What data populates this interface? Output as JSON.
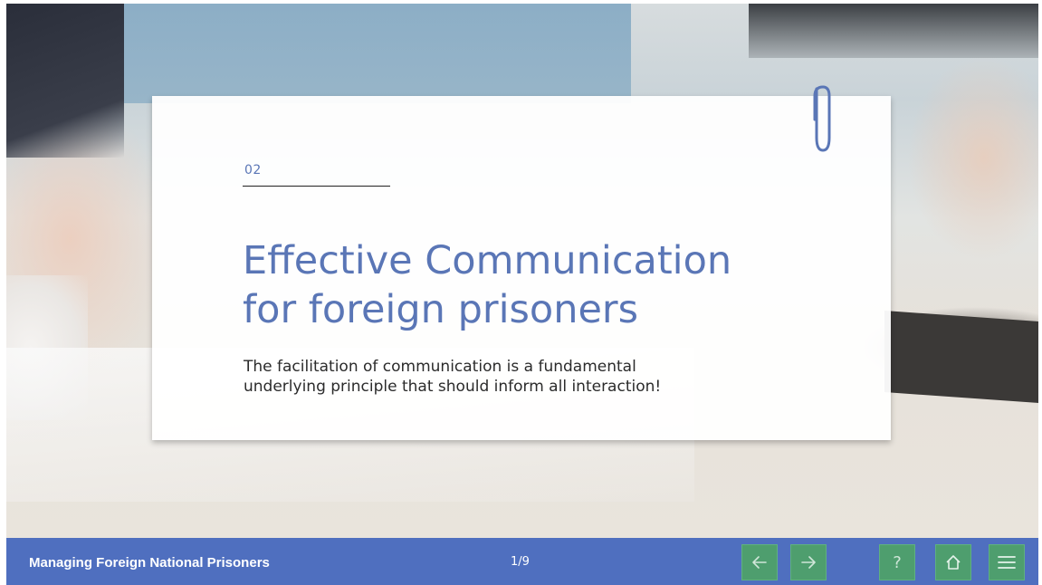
{
  "slide": {
    "section_number": "02",
    "title_lines": [
      "Effective Communication",
      "for foreign prisoners"
    ],
    "body_lines": [
      "The facilitation of communication is a fundamental",
      "underlying principle that should inform all interaction!"
    ]
  },
  "footer": {
    "course_title": "Managing Foreign National Prisoners",
    "page_counter": "1/9",
    "buttons": {
      "prev_icon": "arrow-left-icon",
      "next_icon": "arrow-right-icon",
      "help_label": "?",
      "home_icon": "home-icon",
      "menu_icon": "hamburger-menu-icon"
    }
  },
  "colors": {
    "accent_blue": "#5a76b6",
    "footer_bar": "#4f6fbf",
    "nav_button_green": "#4e9e6e"
  }
}
